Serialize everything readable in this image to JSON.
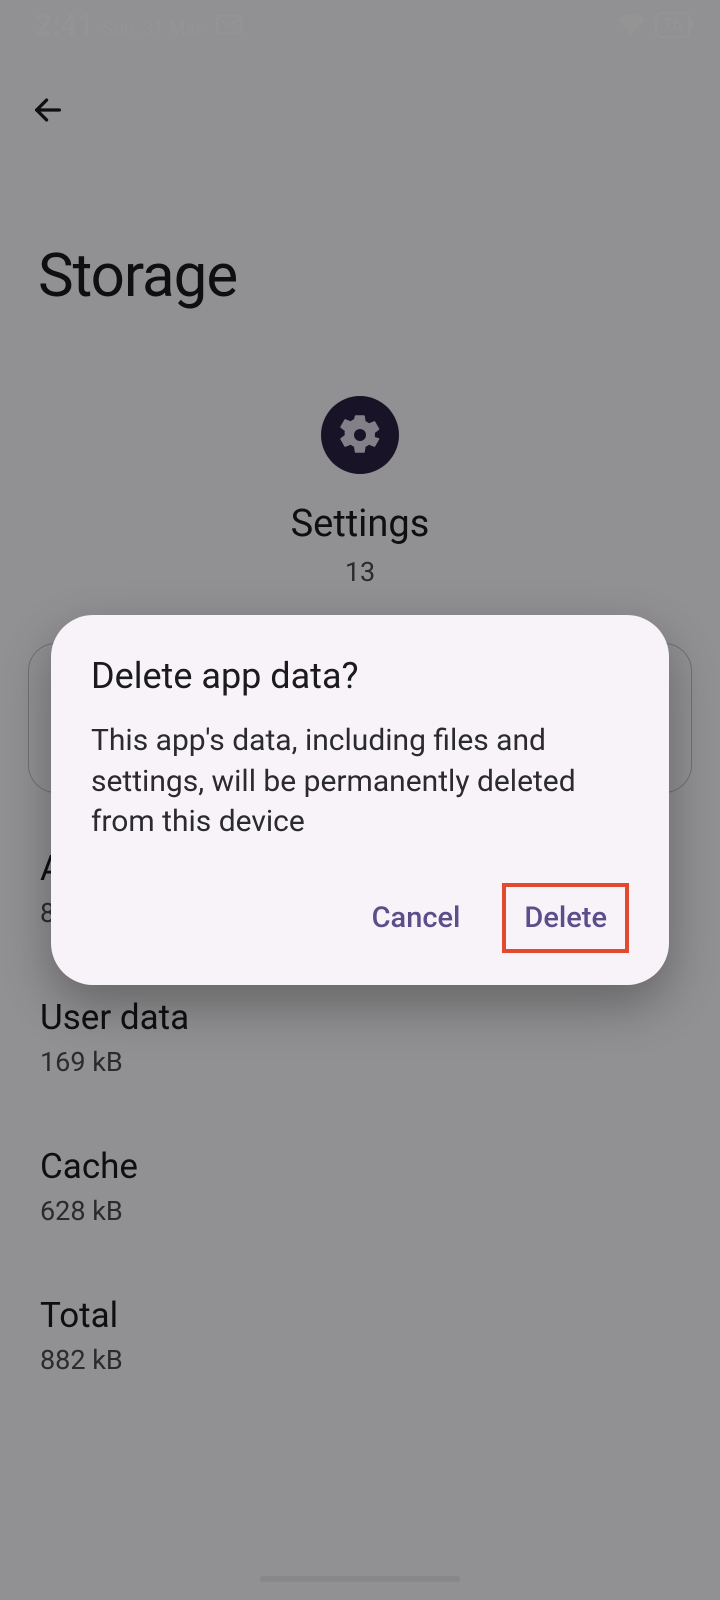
{
  "statusBar": {
    "time": "2:41",
    "date": "Sun, 31 Mar",
    "battery": "76"
  },
  "page": {
    "title": "Storage"
  },
  "app": {
    "name": "Settings",
    "version": "13"
  },
  "storage": {
    "items": [
      {
        "label": "App",
        "value": "84.48 kB"
      },
      {
        "label": "User data",
        "value": "169 kB"
      },
      {
        "label": "Cache",
        "value": "628 kB"
      },
      {
        "label": "Total",
        "value": "882 kB"
      }
    ]
  },
  "dialog": {
    "title": "Delete app data?",
    "message": "This app's data, including files and settings, will be permanently deleted from this device",
    "cancel": "Cancel",
    "confirm": "Delete"
  }
}
